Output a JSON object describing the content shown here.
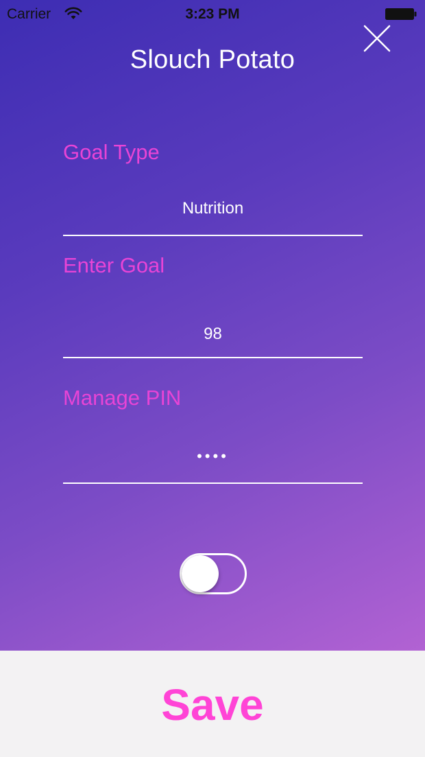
{
  "status_bar": {
    "carrier": "Carrier",
    "time": "3:23 PM"
  },
  "header": {
    "title": "Slouch Potato",
    "close_icon": "close-icon"
  },
  "form": {
    "goal_type": {
      "label": "Goal Type",
      "value": "Nutrition"
    },
    "enter_goal": {
      "label": "Enter Goal",
      "value": "98"
    },
    "manage_pin": {
      "label": "Manage PIN",
      "value": "••••"
    },
    "toggle": {
      "on": false
    }
  },
  "footer": {
    "save_label": "Save"
  },
  "colors": {
    "label_accent": "#e844d6",
    "save_accent": "#ff44d6",
    "gradient_start": "#3d2db3",
    "gradient_end": "#b262d3"
  }
}
